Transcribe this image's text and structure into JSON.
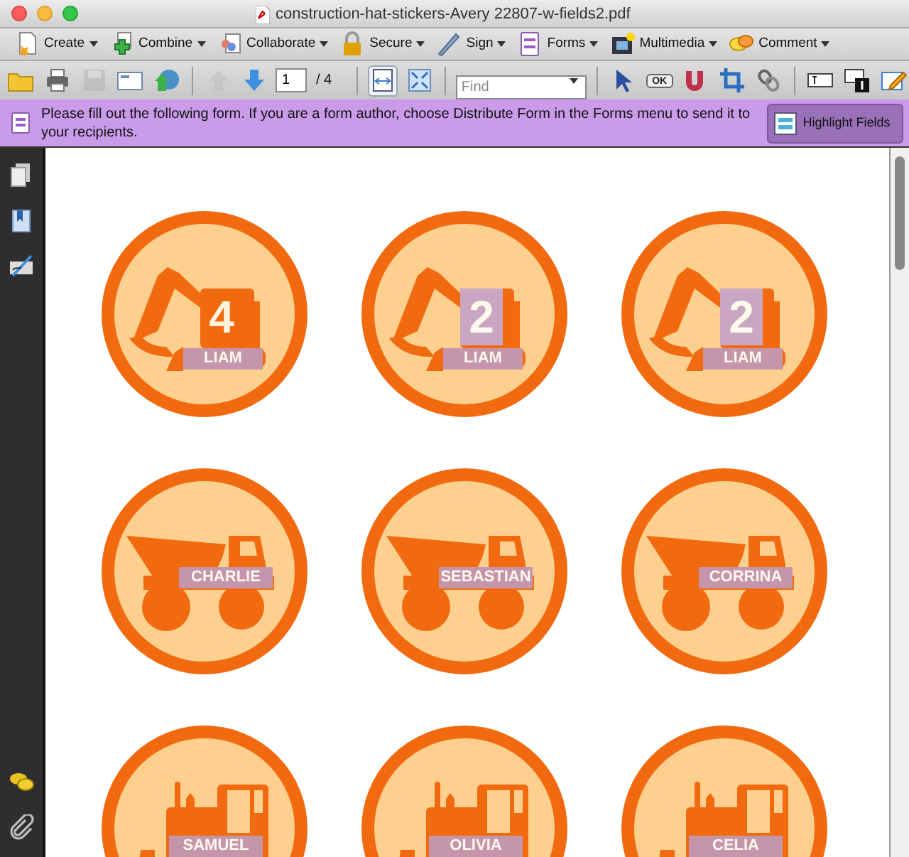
{
  "window": {
    "title": "construction-hat-stickers-Avery 22807-w-fields2.pdf"
  },
  "task_toolbar": [
    {
      "kind": "create",
      "label": "Create"
    },
    {
      "kind": "combine",
      "label": "Combine"
    },
    {
      "kind": "collaborate",
      "label": "Collaborate"
    },
    {
      "kind": "secure",
      "label": "Secure"
    },
    {
      "kind": "sign",
      "label": "Sign"
    },
    {
      "kind": "forms",
      "label": "Forms"
    },
    {
      "kind": "multimedia",
      "label": "Multimedia"
    },
    {
      "kind": "comment",
      "label": "Comment"
    }
  ],
  "main_toolbar": {
    "page_field": "1",
    "page_total": "/ 4",
    "find": {
      "placeholder": "Find"
    },
    "buttons": [
      {
        "kind": "open",
        "disabled": false,
        "selected": false
      },
      {
        "kind": "print",
        "disabled": false,
        "selected": false
      },
      {
        "kind": "save",
        "disabled": true,
        "selected": false
      },
      {
        "kind": "email",
        "disabled": false,
        "selected": false
      },
      {
        "kind": "web",
        "disabled": false,
        "selected": false
      },
      {
        "kind": "prev",
        "disabled": true,
        "selected": false
      },
      {
        "kind": "next",
        "disabled": false,
        "selected": false
      },
      {
        "kind": "page"
      },
      {
        "kind": "fit_width",
        "disabled": false,
        "selected": true
      },
      {
        "kind": "full_screen",
        "disabled": false,
        "selected": false
      },
      {
        "kind": "find"
      },
      {
        "kind": "select",
        "disabled": false,
        "selected": false
      },
      {
        "kind": "ok_button",
        "label": "OK",
        "disabled": false,
        "selected": false
      },
      {
        "kind": "magnet",
        "disabled": false,
        "selected": false
      },
      {
        "kind": "crop",
        "disabled": false,
        "selected": false
      },
      {
        "kind": "link",
        "disabled": false,
        "selected": false
      },
      {
        "kind": "text_field",
        "disabled": false,
        "selected": false
      },
      {
        "kind": "page_number",
        "disabled": false,
        "selected": false
      },
      {
        "kind": "edit",
        "disabled": false,
        "selected": false
      }
    ]
  },
  "form_bar": {
    "message": "Please fill out the following form. If you are a form author, choose Distribute Form in the Forms menu to send it to your recipients.",
    "button": "Highlight Fields"
  },
  "sidebar": {
    "top": [
      {
        "kind": "pages"
      },
      {
        "kind": "bookmarks"
      },
      {
        "kind": "signatures"
      }
    ],
    "bottom": [
      {
        "kind": "comments"
      },
      {
        "kind": "attachments"
      }
    ]
  },
  "stickers": [
    {
      "kind": "excavator",
      "number": "4",
      "number_highlighted": false,
      "name": "LIAM"
    },
    {
      "kind": "excavator",
      "number": "2",
      "number_highlighted": true,
      "name": "LIAM"
    },
    {
      "kind": "excavator",
      "number": "2",
      "number_highlighted": true,
      "name": "LIAM"
    },
    {
      "kind": "dump_truck",
      "name": "CHARLIE"
    },
    {
      "kind": "dump_truck",
      "name": "SEBASTIAN"
    },
    {
      "kind": "dump_truck",
      "name": "CORRINA"
    },
    {
      "kind": "bulldozer",
      "name": "SAMUEL"
    },
    {
      "kind": "bulldozer",
      "name": "OLIVIA"
    },
    {
      "kind": "bulldozer",
      "name": "CELIA"
    }
  ]
}
